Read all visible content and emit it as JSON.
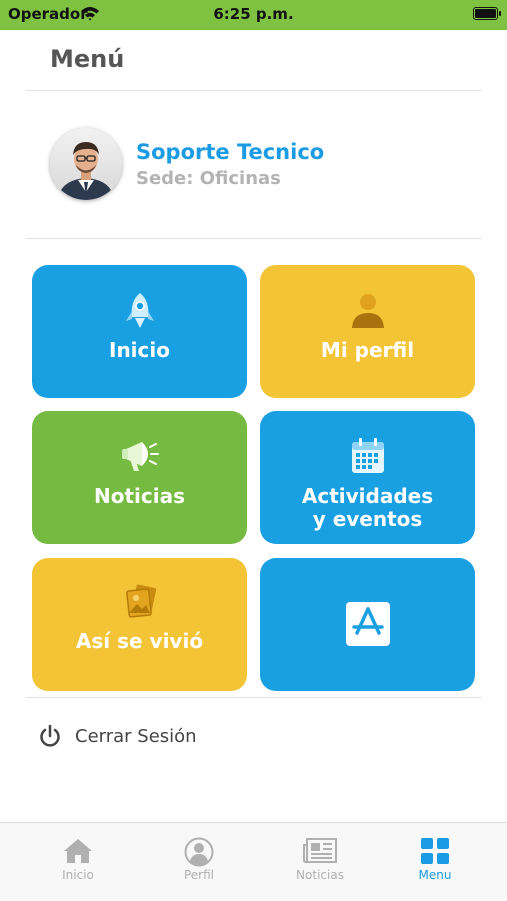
{
  "status_bar": {
    "carrier": "Operador",
    "time": "6:25 p.m."
  },
  "header": {
    "title": "Menú"
  },
  "profile": {
    "name": "Soporte Tecnico",
    "sede": "Sede: Oficinas"
  },
  "tiles": [
    {
      "label": "Inicio",
      "color": "#18a0e3",
      "icon": "rocket-icon"
    },
    {
      "label": "Mi perfil",
      "color": "#f2c436",
      "icon": "person-icon"
    },
    {
      "label": "Noticias",
      "color": "#76bb41",
      "icon": "megaphone-icon"
    },
    {
      "label": "Actividades\ny eventos",
      "color": "#18a0e3",
      "icon": "calendar-icon"
    },
    {
      "label": "Así se vivió",
      "color": "#f2c436",
      "icon": "photos-icon"
    },
    {
      "label": "",
      "color": "#18a0e3",
      "icon": "app-store-icon"
    }
  ],
  "logout": {
    "label": "Cerrar Sesión",
    "icon": "power-icon"
  },
  "tabbar": {
    "active_color": "#1a9be3",
    "items": [
      {
        "label": "Inicio",
        "icon": "home-icon"
      },
      {
        "label": "Perfil",
        "icon": "profile-icon"
      },
      {
        "label": "Noticias",
        "icon": "newspaper-icon"
      },
      {
        "label": "Menu",
        "icon": "grid-icon",
        "active": true
      }
    ]
  }
}
